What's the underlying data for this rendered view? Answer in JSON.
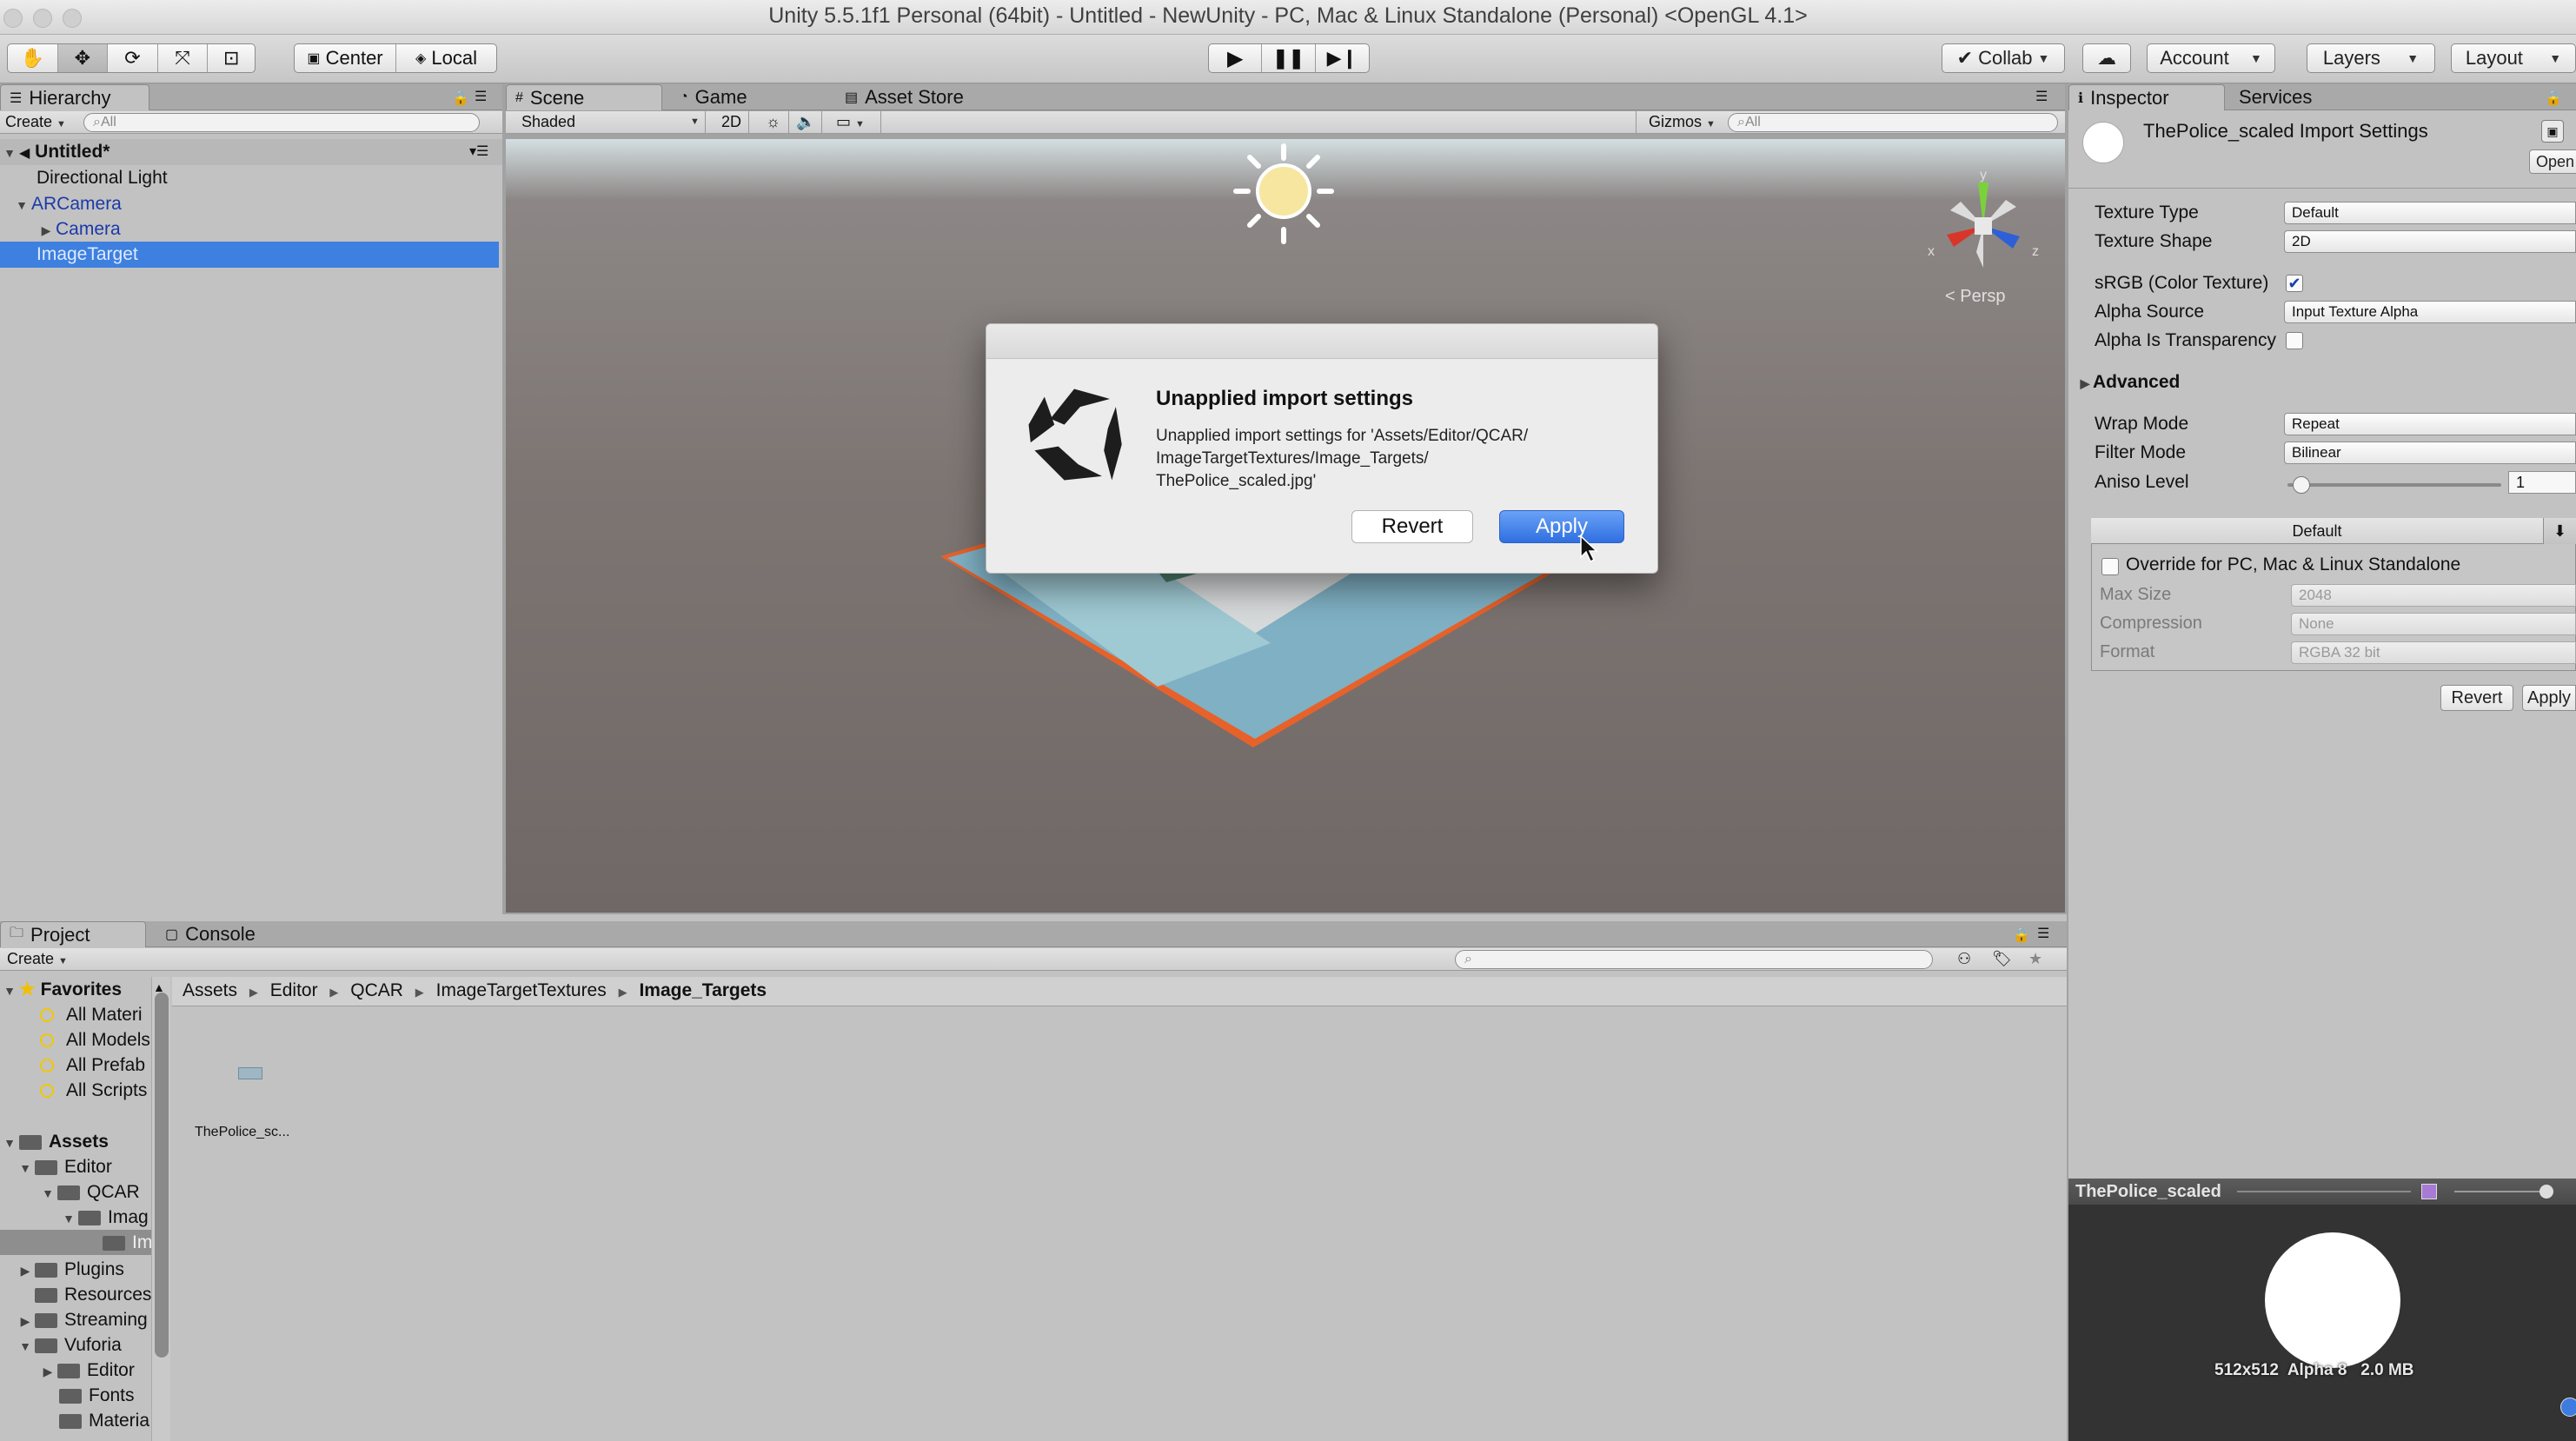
{
  "window": {
    "title": "Unity 5.5.1f1 Personal (64bit) - Untitled - NewUnity - PC, Mac & Linux Standalone (Personal) <OpenGL 4.1>"
  },
  "toolbar": {
    "center": "Center",
    "local": "Local",
    "collab": "Collab",
    "account": "Account",
    "layers": "Layers",
    "layout": "Layout"
  },
  "hierarchy": {
    "tab": "Hierarchy",
    "create": "Create",
    "search_placeholder": "All",
    "scene_name": "Untitled*",
    "items": [
      {
        "label": "Directional Light"
      },
      {
        "label": "ARCamera"
      },
      {
        "label": "Camera"
      },
      {
        "label": "ImageTarget"
      }
    ]
  },
  "scene": {
    "tabs": [
      {
        "label": "Scene"
      },
      {
        "label": "Game"
      },
      {
        "label": "Asset Store"
      }
    ],
    "shaded": "Shaded",
    "mode2d": "2D",
    "gizmos": "Gizmos",
    "search_placeholder": "All",
    "persp": "Persp",
    "axis_x": "x",
    "axis_y": "y",
    "axis_z": "z"
  },
  "dialog": {
    "title": "Unapplied import settings",
    "message_line1": "Unapplied import settings for 'Assets/Editor/QCAR/",
    "message_line2": "ImageTargetTextures/Image_Targets/",
    "message_line3": "ThePolice_scaled.jpg'",
    "revert": "Revert",
    "apply": "Apply"
  },
  "inspector": {
    "tabs": [
      {
        "label": "Inspector"
      },
      {
        "label": "Services"
      }
    ],
    "asset_title": "ThePolice_scaled Import Settings",
    "open": "Open",
    "texture_type_label": "Texture Type",
    "texture_type": "Default",
    "texture_shape_label": "Texture Shape",
    "texture_shape": "2D",
    "srgb_label": "sRGB (Color Texture)",
    "alpha_source_label": "Alpha Source",
    "alpha_source": "Input Texture Alpha",
    "alpha_transparency_label": "Alpha Is Transparency",
    "advanced_label": "Advanced",
    "wrap_mode_label": "Wrap Mode",
    "wrap_mode": "Repeat",
    "filter_mode_label": "Filter Mode",
    "filter_mode": "Bilinear",
    "aniso_label": "Aniso Level",
    "aniso_value": "1",
    "platform_default": "Default",
    "override_label": "Override for PC, Mac & Linux Standalone",
    "max_size_label": "Max Size",
    "max_size": "2048",
    "compression_label": "Compression",
    "compression": "None",
    "format_label": "Format",
    "format": "RGBA 32 bit",
    "revert": "Revert",
    "apply": "Apply"
  },
  "preview": {
    "title": "ThePolice_scaled",
    "info": "512x512  Alpha 8   2.0 MB"
  },
  "project": {
    "tabs": [
      {
        "label": "Project"
      },
      {
        "label": "Console"
      }
    ],
    "create": "Create",
    "favorites": "Favorites",
    "fav_items": [
      {
        "label": "All Materi"
      },
      {
        "label": "All Models"
      },
      {
        "label": "All Prefab"
      },
      {
        "label": "All Scripts"
      }
    ],
    "assets": "Assets",
    "tree": [
      {
        "label": "Editor"
      },
      {
        "label": "QCAR"
      },
      {
        "label": "Imag"
      },
      {
        "label": "Im"
      },
      {
        "label": "Plugins"
      },
      {
        "label": "Resources"
      },
      {
        "label": "Streaming"
      },
      {
        "label": "Vuforia"
      },
      {
        "label": "Editor"
      },
      {
        "label": "Fonts"
      },
      {
        "label": "Materia"
      }
    ],
    "breadcrumb": [
      {
        "label": "Assets"
      },
      {
        "label": "Editor"
      },
      {
        "label": "QCAR"
      },
      {
        "label": "ImageTargetTextures"
      },
      {
        "label": "Image_Targets"
      }
    ],
    "asset_name": "ThePolice_sc..."
  }
}
